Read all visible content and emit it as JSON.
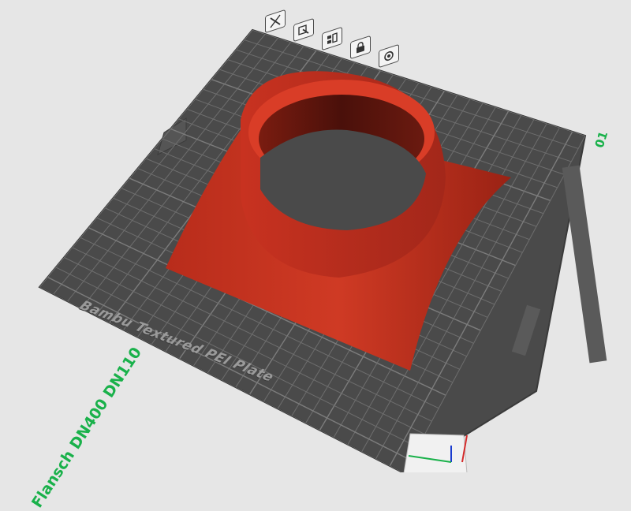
{
  "viewport": {
    "plate_name": "Flansch DN400 DN110",
    "plate_index": "01",
    "plate_label": "Bambu Textured PEI Plate",
    "edit_icon": "pencil-icon"
  },
  "plate_toolbar": {
    "buttons": [
      {
        "name": "close-icon"
      },
      {
        "name": "auto-orient-icon"
      },
      {
        "name": "arrange-icon"
      },
      {
        "name": "lock-icon"
      },
      {
        "name": "settings-icon"
      }
    ]
  },
  "colors": {
    "background": "#e6e6e6",
    "plate": "#4a4a4a",
    "grid": "#6e6e6e",
    "model": "#c8321f",
    "model_dark": "#4a120c",
    "accent": "#19b14a"
  }
}
